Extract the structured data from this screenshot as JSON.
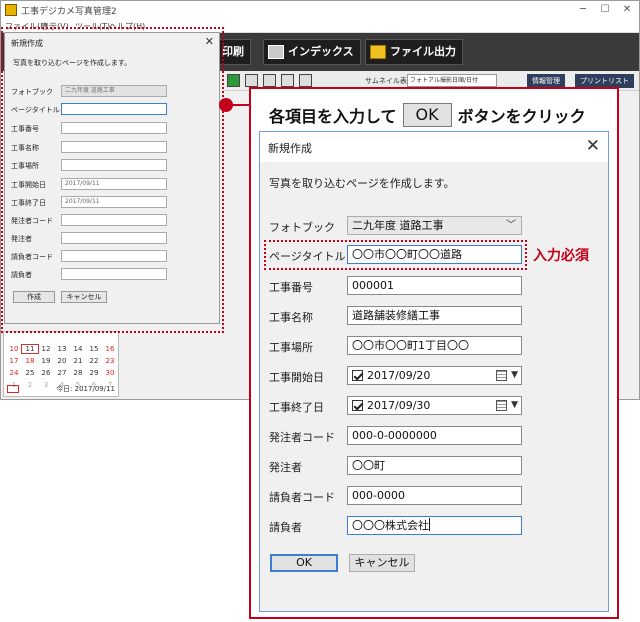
{
  "app": {
    "title": "工事デジカメ写真管理2",
    "menu": [
      "ファイル(F)",
      "表示(V)",
      "ツール(T)",
      "ヘルプ(H)"
    ],
    "toolbar": {
      "print_label": "印刷",
      "index_label": "インデックス",
      "file_output_label": "ファイル出力"
    },
    "subbar": {
      "thumbnail_label": "サムネイル表示",
      "sort_value": "フォトアル撮影日順/日付",
      "info_button": "情報管理",
      "print_list_button": "プリントリスト"
    },
    "calendar": {
      "rows": [
        [
          "10",
          "11",
          "12",
          "13",
          "14",
          "15",
          "16"
        ],
        [
          "17",
          "18",
          "19",
          "20",
          "21",
          "22",
          "23"
        ],
        [
          "24",
          "25",
          "26",
          "27",
          "28",
          "29",
          "30"
        ],
        [
          "1",
          "2",
          "3",
          "4",
          "5",
          "6",
          "7"
        ]
      ],
      "today_label": "今日: 2017/09/11"
    }
  },
  "small_dialog": {
    "title": "新規作成",
    "close": "✕",
    "description": "写真を取り込むページを作成します。",
    "fields": [
      {
        "label": "フォトブック",
        "value": "二九年度 道路工事"
      },
      {
        "label": "ページタイトル",
        "value": ""
      },
      {
        "label": "工事番号",
        "value": ""
      },
      {
        "label": "工事名称",
        "value": ""
      },
      {
        "label": "工事場所",
        "value": ""
      },
      {
        "label": "工事開始日",
        "value": "2017/09/11"
      },
      {
        "label": "工事終了日",
        "value": "2017/09/11"
      },
      {
        "label": "発注者コード",
        "value": ""
      },
      {
        "label": "発注者",
        "value": ""
      },
      {
        "label": "請負者コード",
        "value": ""
      },
      {
        "label": "請負者",
        "value": ""
      }
    ],
    "create_button": "作成",
    "cancel_button": "キャンセル"
  },
  "callout": {
    "heading_before": "各項目を入力して",
    "heading_ok": "OK",
    "heading_after": "ボタンをクリック",
    "required_label": "入力必須"
  },
  "dialog": {
    "title": "新規作成",
    "close": "✕",
    "description": "写真を取り込むページを作成します。",
    "photobook": {
      "label": "フォトブック",
      "value": "二九年度 道路工事"
    },
    "page_title": {
      "label": "ページタイトル",
      "value": "〇〇市〇〇町〇〇道路"
    },
    "construction_number": {
      "label": "工事番号",
      "value": "000001"
    },
    "construction_name": {
      "label": "工事名称",
      "value": "道路舗装修繕工事"
    },
    "construction_location": {
      "label": "工事場所",
      "value": "〇〇市〇〇町1丁目〇〇"
    },
    "start_date": {
      "label": "工事開始日",
      "value": "2017/09/20"
    },
    "end_date": {
      "label": "工事終了日",
      "value": "2017/09/30"
    },
    "client_code": {
      "label": "発注者コード",
      "value": "000-0-0000000"
    },
    "client": {
      "label": "発注者",
      "value": "〇〇町"
    },
    "contractor_code": {
      "label": "請負者コード",
      "value": "000-0000"
    },
    "contractor": {
      "label": "請負者",
      "value": "〇〇〇株式会社"
    },
    "ok_button": "OK",
    "cancel_button": "キャンセル"
  },
  "colors": {
    "accent_red": "#c4001a",
    "focus_blue": "#3c7fd0",
    "toolbar_dark": "#3a3a3a"
  }
}
